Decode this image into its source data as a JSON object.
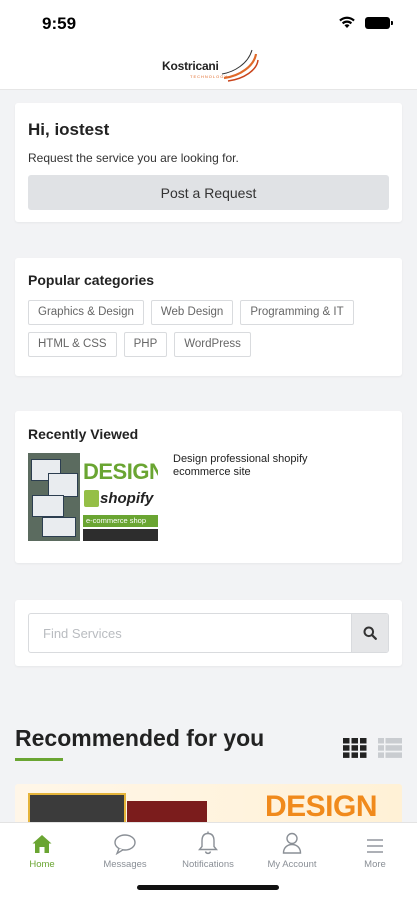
{
  "status_bar": {
    "time": "9:59"
  },
  "header": {
    "logo_text": "Kostricani",
    "logo_tagline": "TECHNOLOGY"
  },
  "greeting": {
    "title": "Hi, iostest",
    "subtitle": "Request the service you are looking for.",
    "button_label": "Post a Request"
  },
  "categories": {
    "title": "Popular categories",
    "items": [
      "Graphics & Design",
      "Web Design",
      "Programming & IT",
      "HTML & CSS",
      "PHP",
      "WordPress"
    ]
  },
  "recently_viewed": {
    "title": "Recently Viewed",
    "items": [
      {
        "title": "Design professional shopify ecommerce site",
        "thumb_heading": "DESIGN",
        "thumb_brand": "shopify",
        "thumb_caption": "e-commerce shop"
      }
    ]
  },
  "search": {
    "placeholder": "Find Services",
    "value": ""
  },
  "recommended": {
    "title": "Recommended for you",
    "view_mode": "grid",
    "first_card_heading": "DESIGN"
  },
  "tabbar": {
    "active": "home",
    "tabs": [
      {
        "id": "home",
        "label": "Home",
        "icon": "home-icon"
      },
      {
        "id": "messages",
        "label": "Messages",
        "icon": "chat-bubble-icon"
      },
      {
        "id": "notifications",
        "label": "Notifications",
        "icon": "bell-icon"
      },
      {
        "id": "account",
        "label": "My Account",
        "icon": "user-icon"
      },
      {
        "id": "more",
        "label": "More",
        "icon": "menu-icon"
      }
    ]
  },
  "colors": {
    "accent": "#6aa532",
    "background": "#f2f3f5",
    "card": "#ffffff",
    "button": "#e0e2e5",
    "orange": "#f08a1c"
  }
}
